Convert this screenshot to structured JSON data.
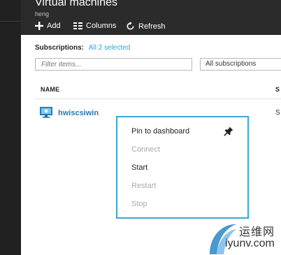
{
  "header": {
    "title": "Virtual machines",
    "subtitle": "heng"
  },
  "toolbar": {
    "add_label": "Add",
    "columns_label": "Columns",
    "refresh_label": "Refresh"
  },
  "subscriptions": {
    "label": "Subscriptions:",
    "value": "All 2 selected"
  },
  "filter": {
    "placeholder": "Filter items..."
  },
  "subscription_select": {
    "selected": "All subscriptions"
  },
  "table": {
    "columns": [
      "NAME",
      "S"
    ],
    "rows": [
      {
        "name": "hwiscsiwin",
        "status": "S"
      }
    ]
  },
  "context_menu": {
    "items": [
      {
        "label": "Pin to dashboard",
        "enabled": true
      },
      {
        "label": "Connect",
        "enabled": false
      },
      {
        "label": "Start",
        "enabled": true
      },
      {
        "label": "Restart",
        "enabled": false
      },
      {
        "label": "Stop",
        "enabled": false
      }
    ]
  },
  "watermark": {
    "line1": "运维网",
    "line2": "iyunv.com"
  },
  "colors": {
    "header_bg": "#2b2b2b",
    "accent": "#2aa2dc",
    "link": "#2876b8",
    "menu_border": "#3aa7d8"
  }
}
